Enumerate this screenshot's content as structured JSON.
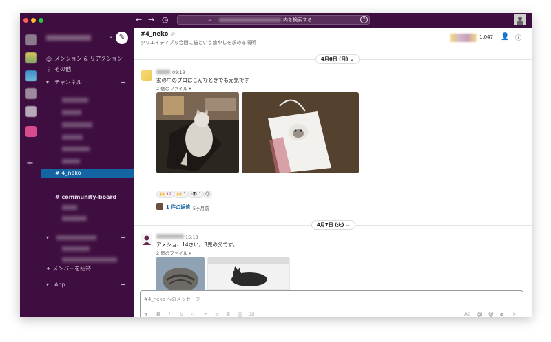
{
  "search": {
    "placeholder": "内を検索する"
  },
  "sidebar": {
    "mentions_label": "メンション & リアクション",
    "more_label": "その他",
    "channels_label": "チャンネル",
    "active_channel": "# 4_neko",
    "channel_partial": "# community-board",
    "invite_label": "+ メンバーを招待",
    "app_label": "App"
  },
  "channel": {
    "title": "#4_neko",
    "topic": "クリエイティブな合間に猫という癒やしを求める場所",
    "member_count": "1,047"
  },
  "messages": [
    {
      "date": "4月6日 (月)",
      "time": "09:19",
      "text": "家の中のプロはこんなときでも元気です",
      "files": "2 個のファイル",
      "reactions": [
        {
          "emoji": "🙌",
          "count": "12"
        },
        {
          "emoji": "🙌",
          "count": "1"
        },
        {
          "emoji": "👁",
          "count": "1"
        }
      ],
      "reply_link": "1 件の返信",
      "reply_time": "5ヶ月前"
    },
    {
      "date": "4月7日 (火)",
      "time": "15:18",
      "text": "アメショ、14さい。3児の父です。",
      "files": "2 個のファイル"
    }
  ],
  "composer": {
    "placeholder": "#4_neko へのメッセージ"
  },
  "colors": {
    "aubergine": "#3f0e40",
    "active_blue": "#1264a3",
    "link_blue": "#1264a3"
  },
  "icons": [
    "back-arrow-icon",
    "forward-arrow-icon",
    "history-clock-icon",
    "search-icon",
    "help-icon",
    "compose-icon",
    "at-icon",
    "more-vertical-icon",
    "add-member-icon",
    "info-icon",
    "lightning-icon",
    "emoji-icon",
    "attach-icon",
    "send-icon"
  ]
}
